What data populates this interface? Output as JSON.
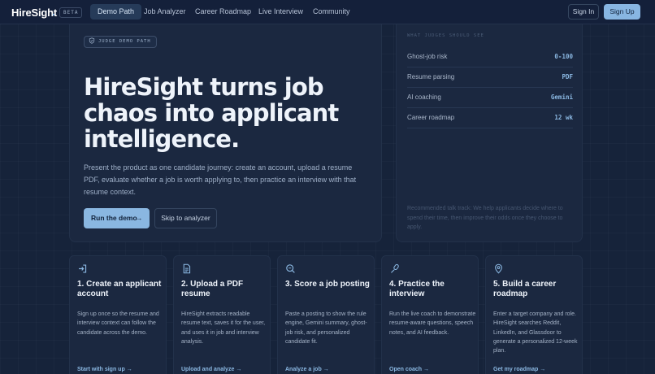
{
  "nav": {
    "logo": "HireSight",
    "logo_dot": ".",
    "badge": "BETA",
    "links": [
      "Demo Path",
      "Job Analyzer",
      "Career Roadmap",
      "Live Interview",
      "Community"
    ],
    "active": "Demo Path",
    "signin": "Sign In",
    "signup": "Sign Up"
  },
  "hero": {
    "pill": "JUDGE DEMO PATH",
    "pill_icon": "shield-check-icon",
    "title": "HireSight turns job chaos into applicant intelligence.",
    "description": "Present the product as one candidate journey: create an account, upload a resume PDF, evaluate whether a job is worth applying to, then practice an interview with that resume context.",
    "primary_button": "Run the demo",
    "primary_button_icon": "arrow-right-icon",
    "secondary_button": "Skip to analyzer"
  },
  "judges": {
    "label": "WHAT JUDGES SHOULD SEE",
    "rows": [
      {
        "label": "Ghost-job risk",
        "value": "0-100"
      },
      {
        "label": "Resume parsing",
        "value": "PDF"
      },
      {
        "label": "AI coaching",
        "value": "Gemini"
      },
      {
        "label": "Career roadmap",
        "value": "12 wk"
      }
    ],
    "note": "Recommended talk track: We help applicants decide where to spend their time, then improve their odds once they choose to apply."
  },
  "steps": [
    {
      "icon": "login-icon",
      "title": "1. Create an applicant account",
      "desc": "Sign up once so the resume and interview context can follow the candidate across the demo.",
      "link": "Start with sign up",
      "arrow": "→"
    },
    {
      "icon": "document-icon",
      "title": "2. Upload a PDF resume",
      "desc": "HireSight extracts readable resume text, saves it for the user, and uses it in job and interview analysis.",
      "link": "Upload and analyze",
      "arrow": "→"
    },
    {
      "icon": "search-icon",
      "title": "3. Score a job posting",
      "desc": "Paste a posting to show the rule engine, Gemini summary, ghost-job risk, and personalized candidate fit.",
      "link": "Analyze a job",
      "arrow": "→"
    },
    {
      "icon": "microphone-icon",
      "title": "4. Practice the interview",
      "desc": "Run the live coach to demonstrate resume-aware questions, speech notes, and AI feedback.",
      "link": "Open coach",
      "arrow": "→"
    },
    {
      "icon": "map-pin-icon",
      "title": "5. Build a career roadmap",
      "desc": "Enter a target company and role. HireSight searches Reddit, LinkedIn, and Glassdoor to generate a personalized 12-week plan.",
      "link": "Get my roadmap",
      "arrow": "→"
    }
  ],
  "colors": {
    "accent": "#8ab7e1",
    "background": "#16233a",
    "panel": "#1b2840"
  }
}
